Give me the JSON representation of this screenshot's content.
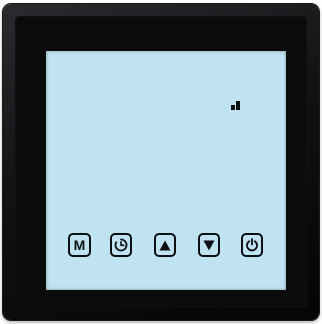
{
  "device": {
    "screen": {
      "signal_icon": "signal-strength-icon",
      "buttons": [
        {
          "id": "mode",
          "label": "M",
          "icon": "mode-icon"
        },
        {
          "id": "timer",
          "icon": "clock-icon"
        },
        {
          "id": "up",
          "icon": "arrow-up-icon"
        },
        {
          "id": "down",
          "icon": "arrow-down-icon"
        },
        {
          "id": "power",
          "icon": "power-icon"
        }
      ]
    },
    "colors": {
      "lcd_background": "#bfe3f1",
      "bezel": "#111214",
      "glyph": "#0d0f12"
    }
  }
}
